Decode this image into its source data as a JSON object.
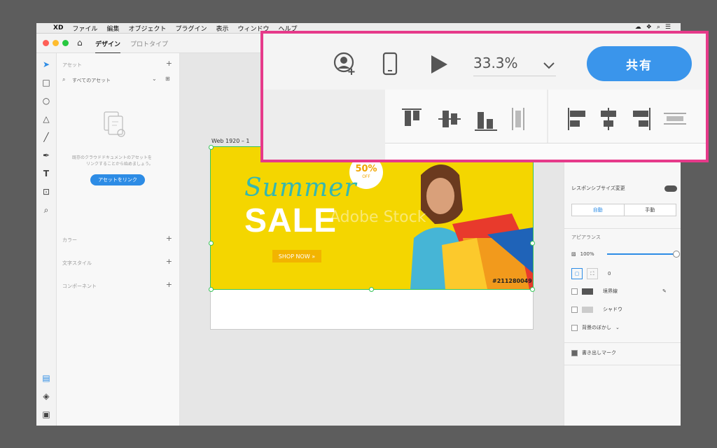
{
  "menubar": {
    "app": "XD",
    "items": [
      "ファイル",
      "編集",
      "オブジェクト",
      "プラグイン",
      "表示",
      "ウィンドウ",
      "ヘルプ"
    ]
  },
  "tabs": {
    "design": "デザイン",
    "prototype": "プロトタイプ"
  },
  "assets": {
    "header": "アセット",
    "filter": "すべてのアセット",
    "empty_text_1": "既存のクラウドドキュメントのアセットを",
    "empty_text_2": "リンクすることから始めましょう。",
    "link_button": "アセットをリンク",
    "sections": [
      "カラー",
      "文字スタイル",
      "コンポーネント"
    ]
  },
  "canvas": {
    "artboard_label": "Web 1920 – 1",
    "banner": {
      "summer": "Summer",
      "sale": "SALE",
      "shop_now": "SHOP NOW »",
      "badge_pct": "50%",
      "badge_off": "OFF",
      "stock_id": "#211280049",
      "watermark": "Adobe Stock"
    }
  },
  "properties": {
    "responsive_label": "レスポンシブサイズ変更",
    "auto": "自動",
    "manual": "手動",
    "appearance": "アピアランス",
    "opacity": "100%",
    "opacity_value": 1.0,
    "radius": "0",
    "border": "境界線",
    "shadow": "シャドウ",
    "bg_blur": "背景のぼかし",
    "export_mark": "書き出しマーク"
  },
  "zoom": {
    "value": "33.3%",
    "share": "共有"
  },
  "colors": {
    "accent": "#2d8ce5",
    "highlight": "#e63a8a",
    "banner_bg": "#f4d600"
  }
}
